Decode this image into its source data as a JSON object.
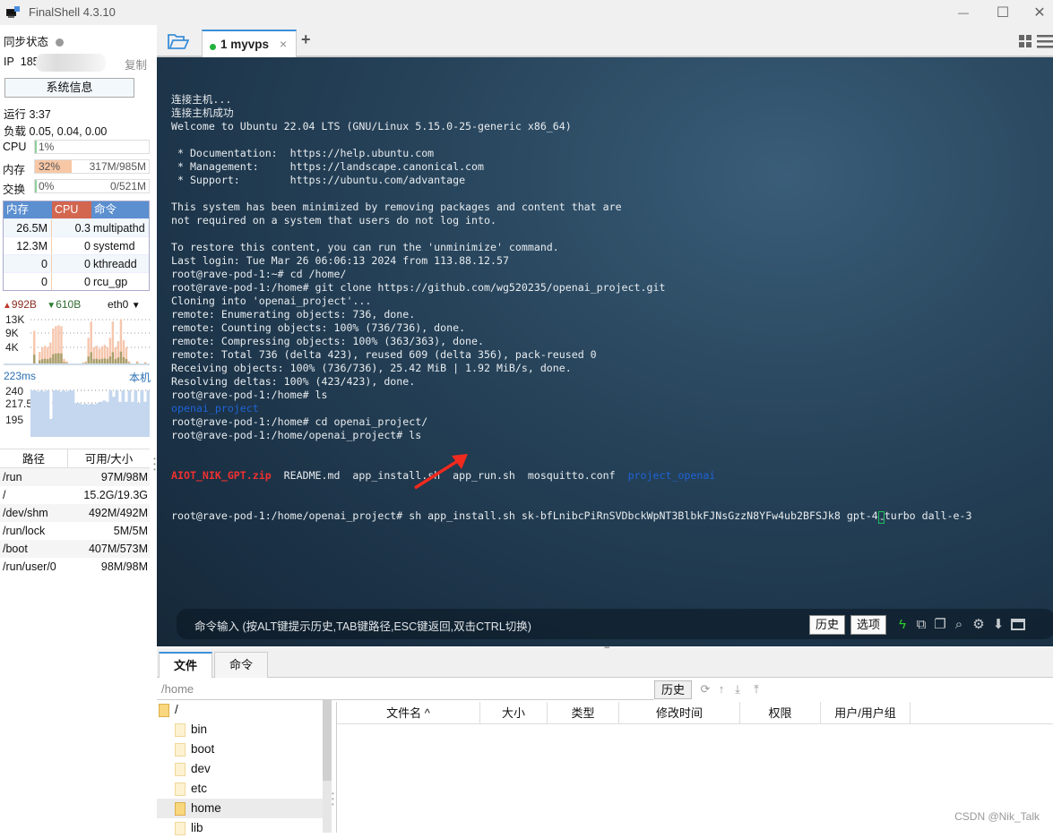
{
  "window": {
    "title": "FinalShell 4.3.10",
    "controls": {
      "minimize": "—",
      "maximize": "☐",
      "close": "✕"
    }
  },
  "left_panel": {
    "sync_label": "同步状态",
    "ip_label": "IP",
    "ip_value": "185",
    "copy_label": "复制",
    "sysinfo_button": "系统信息",
    "uptime": "运行 3:37",
    "load": "负载 0.05, 0.04, 0.00",
    "meters": [
      {
        "label": "CPU",
        "percent_text": "1%",
        "value": "",
        "fill_fraction": 0.01,
        "fill_color": "#8fd19e"
      },
      {
        "label": "内存",
        "percent_text": "32%",
        "value": "317M/985M",
        "fill_fraction": 0.32,
        "fill_color": "#f8c7a5"
      },
      {
        "label": "交换",
        "percent_text": "0%",
        "value": "0/521M",
        "fill_fraction": 0.0,
        "fill_color": "#8fd19e"
      }
    ],
    "process_table": {
      "headers": [
        "内存",
        "CPU",
        "命令"
      ],
      "header_colors": [
        "#5b8fd0",
        "#d3664f",
        "#5b8fd0"
      ],
      "rows": [
        {
          "mem": "26.5M",
          "cpu": "0.3",
          "cmd": "multipathd"
        },
        {
          "mem": "12.3M",
          "cpu": "0",
          "cmd": "systemd"
        },
        {
          "mem": "0",
          "cpu": "0",
          "cmd": "kthreadd"
        },
        {
          "mem": "0",
          "cpu": "0",
          "cmd": "rcu_gp"
        }
      ]
    },
    "network": {
      "upload": "992B",
      "download": "610B",
      "interface": "eth0",
      "y_ticks": [
        "13K",
        "9K",
        "4K"
      ]
    },
    "ping": {
      "latency": "223ms",
      "target": "本机",
      "y_ticks": [
        "240",
        "217.5",
        "195"
      ]
    },
    "disk_table": {
      "headers": [
        "路径",
        "可用/大小"
      ],
      "rows": [
        {
          "path": "/run",
          "size": "97M/98M"
        },
        {
          "path": "/",
          "size": "15.2G/19.3G"
        },
        {
          "path": "/dev/shm",
          "size": "492M/492M"
        },
        {
          "path": "/run/lock",
          "size": "5M/5M"
        },
        {
          "path": "/boot",
          "size": "407M/573M"
        },
        {
          "path": "/run/user/0",
          "size": "98M/98M"
        }
      ]
    }
  },
  "tabs": {
    "items": [
      {
        "number": "1",
        "label": "1 myvps",
        "status": "connected"
      }
    ],
    "close_glyph": "×",
    "add_glyph": "+"
  },
  "terminal": {
    "lines": [
      {
        "text": "连接主机..."
      },
      {
        "text": "连接主机成功"
      },
      {
        "text": "Welcome to Ubuntu 22.04 LTS (GNU/Linux 5.15.0-25-generic x86_64)"
      },
      {
        "text": ""
      },
      {
        "text": " * Documentation:  https://help.ubuntu.com"
      },
      {
        "text": " * Management:     https://landscape.canonical.com"
      },
      {
        "text": " * Support:        https://ubuntu.com/advantage"
      },
      {
        "text": ""
      },
      {
        "text": "This system has been minimized by removing packages and content that are"
      },
      {
        "text": "not required on a system that users do not log into."
      },
      {
        "text": ""
      },
      {
        "text": "To restore this content, you can run the 'unminimize' command."
      },
      {
        "text": "Last login: Tue Mar 26 06:06:13 2024 from 113.88.12.57"
      },
      {
        "text": "root@rave-pod-1:~# cd /home/"
      },
      {
        "text": "root@rave-pod-1:/home# git clone https://github.com/wg520235/openai_project.git"
      },
      {
        "text": "Cloning into 'openai_project'..."
      },
      {
        "text": "remote: Enumerating objects: 736, done."
      },
      {
        "text": "remote: Counting objects: 100% (736/736), done."
      },
      {
        "text": "remote: Compressing objects: 100% (363/363), done."
      },
      {
        "text": "remote: Total 736 (delta 423), reused 609 (delta 356), pack-reused 0"
      },
      {
        "text": "Receiving objects: 100% (736/736), 25.42 MiB | 1.92 MiB/s, done."
      },
      {
        "text": "Resolving deltas: 100% (423/423), done."
      },
      {
        "text": "root@rave-pod-1:/home# ls"
      },
      {
        "text": "openai_project",
        "style": "blue"
      },
      {
        "text": "root@rave-pod-1:/home# cd openai_project/"
      },
      {
        "text": "root@rave-pod-1:/home/openai_project# ls"
      }
    ],
    "ls_output": {
      "red_item": "AIOT_NIK_GPT.zip",
      "plain_items": "  README.md  app_install.sh  app_run.sh  mosquitto.conf  ",
      "blue_item": "project_openai"
    },
    "current_command": {
      "before_cursor": "root@rave-pod-1:/home/openai_project# sh app_install.sh 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 gpt-4",
      "cursor_char": "-",
      "after_cursor": "turbo dall-e-3"
    },
    "command_bar": {
      "hint": "命令输入 (按ALT键提示历史,TAB键路径,ESC键返回,双击CTRL切换)",
      "history_button": "历史",
      "options_button": "选项"
    }
  },
  "file_pane": {
    "tabs": [
      "文件",
      "命令"
    ],
    "path_value": "/home",
    "history_button": "历史",
    "tree": [
      {
        "name": "/",
        "level": 0,
        "selected": false,
        "strong": true
      },
      {
        "name": "bin",
        "level": 1,
        "selected": false,
        "strong": false
      },
      {
        "name": "boot",
        "level": 1,
        "selected": false,
        "strong": false
      },
      {
        "name": "dev",
        "level": 1,
        "selected": false,
        "strong": false
      },
      {
        "name": "etc",
        "level": 1,
        "selected": false,
        "strong": false
      },
      {
        "name": "home",
        "level": 1,
        "selected": true,
        "strong": true
      },
      {
        "name": "lib",
        "level": 1,
        "selected": false,
        "strong": false
      }
    ],
    "columns": [
      "文件名 ^",
      "大小",
      "类型",
      "修改时间",
      "权限",
      "用户/用户组"
    ]
  },
  "watermark": "CSDN @Nik_Talk"
}
